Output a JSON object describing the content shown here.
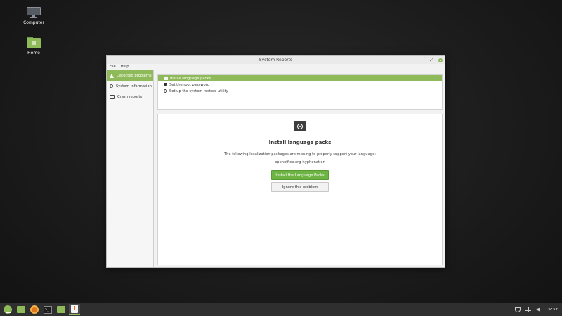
{
  "desktop": {
    "icons": [
      {
        "label": "Computer",
        "icon": "computer-icon"
      },
      {
        "label": "Home",
        "icon": "home-folder-icon"
      }
    ]
  },
  "window": {
    "title": "System Reports",
    "controls": [
      "minimize-icon",
      "maximize-icon",
      "close-icon"
    ],
    "menu": [
      "File",
      "Help"
    ],
    "sidebar": [
      {
        "label": "Detected problems",
        "icon": "warning-icon",
        "active": true
      },
      {
        "label": "System information",
        "icon": "location-pin-icon",
        "active": false
      },
      {
        "label": "Crash reports",
        "icon": "monitor-icon",
        "active": false
      }
    ],
    "problems": [
      {
        "label": "Install language packs",
        "icon": "message-icon",
        "selected": true
      },
      {
        "label": "Set the root password",
        "icon": "shield-icon",
        "selected": false
      },
      {
        "label": "Set up the system restore utility",
        "icon": "clock-icon",
        "selected": false
      }
    ],
    "detail": {
      "icon": "language-icon",
      "title": "Install language packs",
      "description": "The following localization packages are missing to properly support your language:",
      "package": "openoffice.org-hyphenation",
      "primary_button": "Install the Language Packs",
      "secondary_button": "Ignore this problem"
    }
  },
  "taskbar": {
    "items": [
      {
        "icon": "mint-menu-icon"
      },
      {
        "icon": "show-desktop-icon"
      },
      {
        "icon": "firefox-icon"
      },
      {
        "icon": "terminal-icon"
      },
      {
        "icon": "files-icon"
      },
      {
        "icon": "system-reports-icon",
        "active": true
      }
    ],
    "tray": {
      "icons": [
        "shield-icon",
        "network-icon",
        "volume-icon"
      ],
      "time": "15:32"
    }
  },
  "colors": {
    "accent": "#8fba5a",
    "primary_button": "#6db442",
    "taskbar": "#2f2f2f"
  }
}
